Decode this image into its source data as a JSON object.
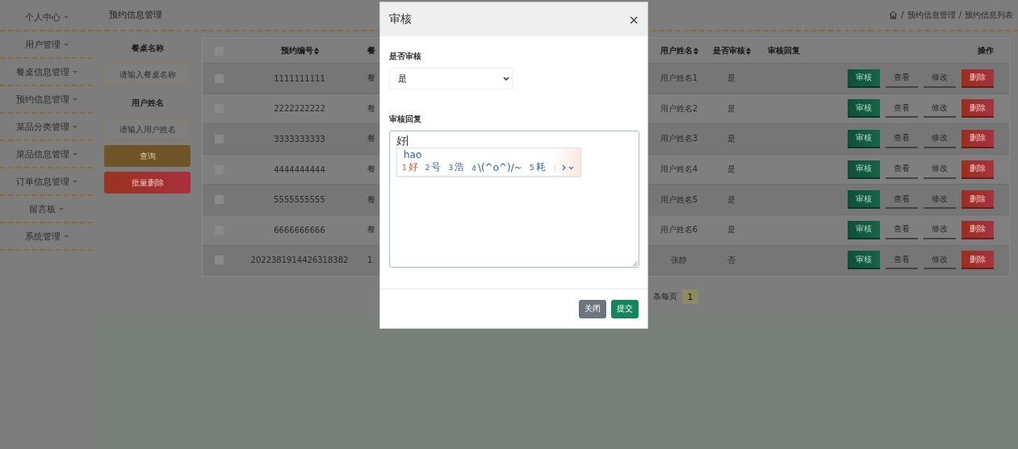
{
  "sidebar": {
    "items": [
      {
        "label": "个人中心"
      },
      {
        "label": "用户管理"
      },
      {
        "label": "餐桌信息管理"
      },
      {
        "label": "预约信息管理"
      },
      {
        "label": "菜品分类管理"
      },
      {
        "label": "菜品信息管理"
      },
      {
        "label": "订单信息管理"
      },
      {
        "label": "留言板"
      },
      {
        "label": "系统管理"
      }
    ]
  },
  "header": {
    "title": "预约信息管理",
    "breadcrumb_separator": "/",
    "breadcrumb": [
      "预约信息管理",
      "预约信息列表"
    ]
  },
  "filters": {
    "fields": [
      {
        "label": "餐桌名称",
        "placeholder": "请输入餐桌名称"
      },
      {
        "label": "用户姓名",
        "placeholder": "请输入用户姓名"
      }
    ],
    "buttons": [
      {
        "label": "查询",
        "kind": "search"
      },
      {
        "label": "批量删除",
        "kind": "danger"
      }
    ]
  },
  "table": {
    "select_all": {
      "checked": false
    },
    "columns": [
      {
        "label": "预约编号",
        "sortable": true
      },
      {
        "label": "餐",
        "sortable": false
      },
      {
        "label": "用户姓名",
        "sortable": true
      },
      {
        "label": "是否审核",
        "sortable": true
      },
      {
        "label": "审核回复",
        "sortable": false
      },
      {
        "label": "操作",
        "sortable": false
      }
    ],
    "rows": [
      {
        "checked": false,
        "booking_no": "1111111111",
        "column_3": "餐",
        "user_name": "用户姓名1",
        "reviewed": "是",
        "actions": [
          {
            "label": "审核",
            "kind": "primary"
          },
          {
            "label": "查看",
            "kind": "plain"
          },
          {
            "label": "修改",
            "kind": "plain"
          },
          {
            "label": "删除",
            "kind": "danger"
          }
        ]
      },
      {
        "checked": false,
        "booking_no": "2222222222",
        "column_3": "餐",
        "user_name": "用户姓名2",
        "reviewed": "是",
        "actions": [
          {
            "label": "审核",
            "kind": "primary"
          },
          {
            "label": "查看",
            "kind": "plain"
          },
          {
            "label": "修改",
            "kind": "plain"
          },
          {
            "label": "删除",
            "kind": "danger"
          }
        ]
      },
      {
        "checked": false,
        "booking_no": "3333333333",
        "column_3": "餐",
        "user_name": "用户姓名3",
        "reviewed": "是",
        "actions": [
          {
            "label": "审核",
            "kind": "primary"
          },
          {
            "label": "查看",
            "kind": "plain"
          },
          {
            "label": "修改",
            "kind": "plain"
          },
          {
            "label": "删除",
            "kind": "danger"
          }
        ]
      },
      {
        "checked": false,
        "booking_no": "4444444444",
        "column_3": "餐",
        "user_name": "用户姓名4",
        "reviewed": "是",
        "actions": [
          {
            "label": "审核",
            "kind": "primary"
          },
          {
            "label": "查看",
            "kind": "plain"
          },
          {
            "label": "修改",
            "kind": "plain"
          },
          {
            "label": "删除",
            "kind": "danger"
          }
        ]
      },
      {
        "checked": false,
        "booking_no": "5555555555",
        "column_3": "餐",
        "user_name": "用户姓名5",
        "reviewed": "是",
        "actions": [
          {
            "label": "审核",
            "kind": "primary"
          },
          {
            "label": "查看",
            "kind": "plain"
          },
          {
            "label": "修改",
            "kind": "plain"
          },
          {
            "label": "删除",
            "kind": "danger"
          }
        ]
      },
      {
        "checked": false,
        "booking_no": "6666666666",
        "column_3": "餐",
        "user_name": "用户姓名6",
        "reviewed": "是",
        "actions": [
          {
            "label": "审核",
            "kind": "primary"
          },
          {
            "label": "查看",
            "kind": "plain"
          },
          {
            "label": "修改",
            "kind": "plain"
          },
          {
            "label": "删除",
            "kind": "danger"
          }
        ]
      },
      {
        "checked": false,
        "booking_no": "2022381914426318382",
        "column_3": "1",
        "user_name": "张静",
        "reviewed": "否",
        "actions": [
          {
            "label": "审核",
            "kind": "primary"
          },
          {
            "label": "查看",
            "kind": "plain"
          },
          {
            "label": "修改",
            "kind": "plain"
          },
          {
            "label": "删除",
            "kind": "danger"
          }
        ]
      }
    ]
  },
  "pagination": {
    "per_page_label": "条每页",
    "pages": [
      "1"
    ]
  },
  "modal": {
    "title": "审核",
    "close": "×",
    "fields": [
      {
        "label": "是否审核",
        "kind": "select",
        "value": "是"
      },
      {
        "label": "审核回复",
        "kind": "textarea",
        "value": "好"
      }
    ],
    "ime": {
      "composition": "hao",
      "candidates": [
        {
          "index": "1",
          "text": "好",
          "selected": true
        },
        {
          "index": "2",
          "text": "号",
          "selected": false
        },
        {
          "index": "3",
          "text": "浩",
          "selected": false
        },
        {
          "index": "4",
          "text": "\\(^o^)/~",
          "selected": false
        },
        {
          "index": "5",
          "text": "耗",
          "selected": false
        }
      ]
    },
    "buttons": [
      {
        "label": "关闭",
        "kind": "secondary"
      },
      {
        "label": "提交",
        "kind": "primary"
      }
    ]
  }
}
